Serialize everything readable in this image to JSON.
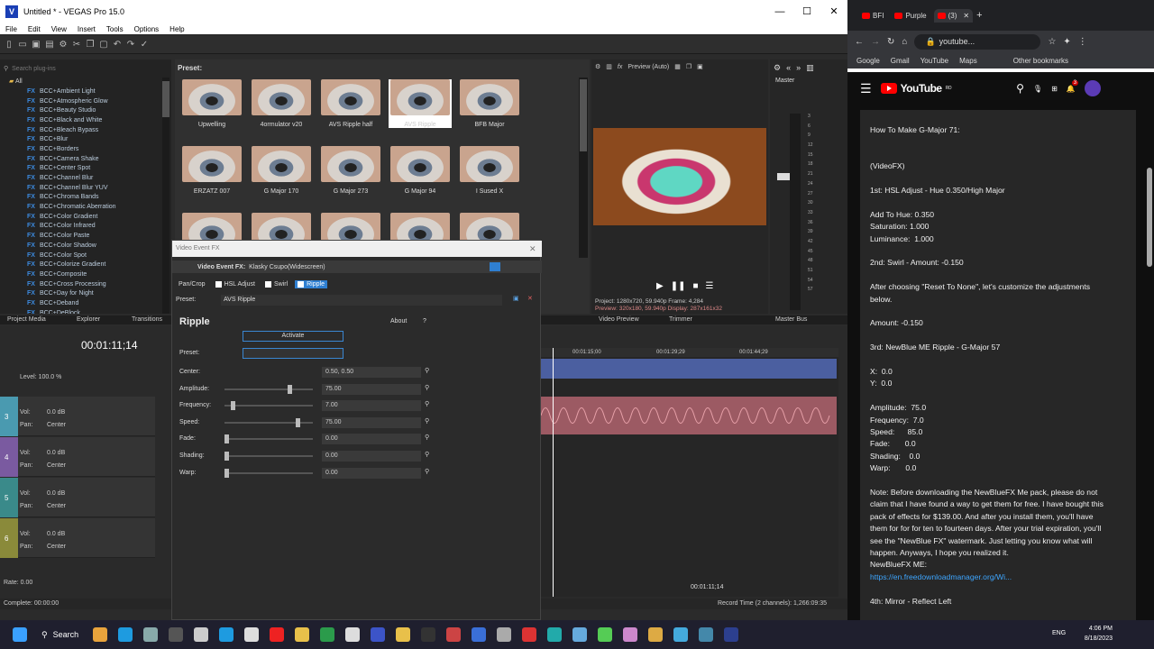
{
  "vegas": {
    "title": "Untitled * - VEGAS Pro 15.0",
    "menu": [
      "File",
      "Edit",
      "View",
      "Insert",
      "Tools",
      "Options",
      "Help"
    ],
    "plugins": {
      "search_placeholder": "Search plug-ins",
      "root": "All",
      "items": [
        "BCC+Ambient Light",
        "BCC+Atmospheric Glow",
        "BCC+Beauty Studio",
        "BCC+Black and White",
        "BCC+Bleach Bypass",
        "BCC+Blur",
        "BCC+Borders",
        "BCC+Camera Shake",
        "BCC+Center Spot",
        "BCC+Channel Blur",
        "BCC+Channel Blur YUV",
        "BCC+Chroma Bands",
        "BCC+Chromatic Aberration",
        "BCC+Color Gradient",
        "BCC+Color Infrared",
        "BCC+Color Paste",
        "BCC+Color Shadow",
        "BCC+Color Spot",
        "BCC+Colorize Gradient",
        "BCC+Composite",
        "BCC+Cross Processing",
        "BCC+Day for Night",
        "BCC+Deband",
        "BCC+DeBlock"
      ],
      "fx_tag": "FX"
    },
    "presets": {
      "header": "Preset:",
      "items": [
        "Upwelling",
        "4ormulator v20",
        "AVS Ripple half",
        "AVS Ripple",
        "BFB Major",
        "ERZATZ 007",
        "G Major 170",
        "G Major 273",
        "G Major 94",
        "I Sused X"
      ]
    },
    "preview": {
      "label": "Preview (Auto)",
      "info_line1": "Project:  1280x720, 59.940p   Frame:        4,284",
      "info_line2": "Preview:  320x180, 59.940p   Display:  287x161x32"
    },
    "master": {
      "label": "Master",
      "scale": [
        "3",
        "6",
        "9",
        "12",
        "15",
        "18",
        "21",
        "24",
        "27",
        "30",
        "33",
        "36",
        "39",
        "42",
        "45",
        "48",
        "51",
        "54",
        "57"
      ]
    },
    "tabs": {
      "project_media": "Project Media",
      "explorer": "Explorer",
      "transitions": "Transitions",
      "video_preview": "Video Preview",
      "trimmer": "Trimmer",
      "master_bus": "Master Bus"
    },
    "timeline": {
      "timecode": "00:01:11;14",
      "ruler": [
        "00:01:15;00",
        "00:01:29;29",
        "00:01:44;29"
      ],
      "level": "Level: 100.0 %",
      "rate": "Rate: 0.00",
      "cursor_time": "00:01:11;14",
      "record_time": "Record Time (2 channels): 1,266:09:35",
      "complete": "Complete: 00:00:00",
      "tracks": [
        {
          "num": "3",
          "vol": "Vol:",
          "vol_val": "0.0 dB",
          "pan": "Pan:",
          "pan_val": "Center",
          "color": "#4a9ab0"
        },
        {
          "num": "4",
          "vol": "Vol:",
          "vol_val": "0.0 dB",
          "pan": "Pan:",
          "pan_val": "Center",
          "color": "#7a5aa0"
        },
        {
          "num": "5",
          "vol": "Vol:",
          "vol_val": "0.0 dB",
          "pan": "Pan:",
          "pan_val": "Center",
          "color": "#3a8a8a"
        },
        {
          "num": "6",
          "vol": "Vol:",
          "vol_val": "0.0 dB",
          "pan": "Pan:",
          "pan_val": "Center",
          "color": "#8a8a3a"
        }
      ]
    },
    "fx": {
      "window_title": "Video Event FX",
      "bar_title": "Video Event FX:",
      "media_name": "Klasky Csupo(Widescreen)",
      "chain": [
        "Pan/Crop",
        "HSL Adjust",
        "Swirl",
        "Ripple"
      ],
      "preset_label": "Preset:",
      "preset_value": "AVS Ripple",
      "plugin_name": "Ripple",
      "about": "About",
      "help": "?",
      "activate": "Activate",
      "inner_preset": "Preset:",
      "params": [
        {
          "label": "Center:",
          "value": "0.50, 0.50",
          "pos": 0
        },
        {
          "label": "Amplitude:",
          "value": "75.00",
          "pos": 0.75
        },
        {
          "label": "Frequency:",
          "value": "7.00",
          "pos": 0.07
        },
        {
          "label": "Speed:",
          "value": "75.00",
          "pos": 0.85
        },
        {
          "label": "Fade:",
          "value": "0.00",
          "pos": 0
        },
        {
          "label": "Shading:",
          "value": "0.00",
          "pos": 0
        },
        {
          "label": "Warp:",
          "value": "0.00",
          "pos": 0
        }
      ]
    }
  },
  "chrome": {
    "tabs": [
      "BFI",
      "Purple",
      "(3)"
    ],
    "url": "youtube...",
    "bookmarks": [
      "Google",
      "Gmail",
      "YouTube",
      "Maps",
      "Other bookmarks"
    ],
    "yt_brand": "YouTube",
    "yt_region": "RO",
    "notif_count": "3",
    "description": [
      "How To Make G-Major 71:",
      "",
      "",
      "(VideoFX)",
      "",
      "1st: HSL Adjust - Hue 0.350/High Major",
      "",
      "Add To Hue: 0.350",
      "Saturation: 1.000",
      "Luminance:  1.000",
      "",
      "2nd: Swirl - Amount: -0.150",
      "",
      "After choosing \"Reset To None\", let's customize the adjustments",
      "below.",
      "",
      "Amount: -0.150",
      "",
      "3rd: NewBlue ME Ripple - G-Major 57",
      "",
      "X:  0.0",
      "Y:  0.0",
      "",
      "Amplitude:  75.0",
      "Frequency:  7.0",
      "Speed:      85.0",
      "Fade:       0.0",
      "Shading:    0.0",
      "Warp:       0.0",
      "",
      "Note: Before downloading the NewBlueFX Me pack, please do not",
      "claim that I have found a way to get them for free. I have bought this",
      "pack of effects for $139.00. And after you install them, you'll have",
      "them for for for ten to fourteen days. After your trial expiration, you'll",
      "see the \"NewBlue FX\" watermark. Just letting you know what will",
      "happen. Anyways, I hope you realized it.",
      "NewBlueFX ME:"
    ],
    "link": "https://en.freedownloadmanager.org/Wi...",
    "description_tail": [
      "",
      "4th: Mirror - Reflect Left"
    ]
  },
  "taskbar": {
    "search": "Search",
    "lang": "ENG",
    "time": "4:06 PM",
    "date": "8/18/2023"
  }
}
